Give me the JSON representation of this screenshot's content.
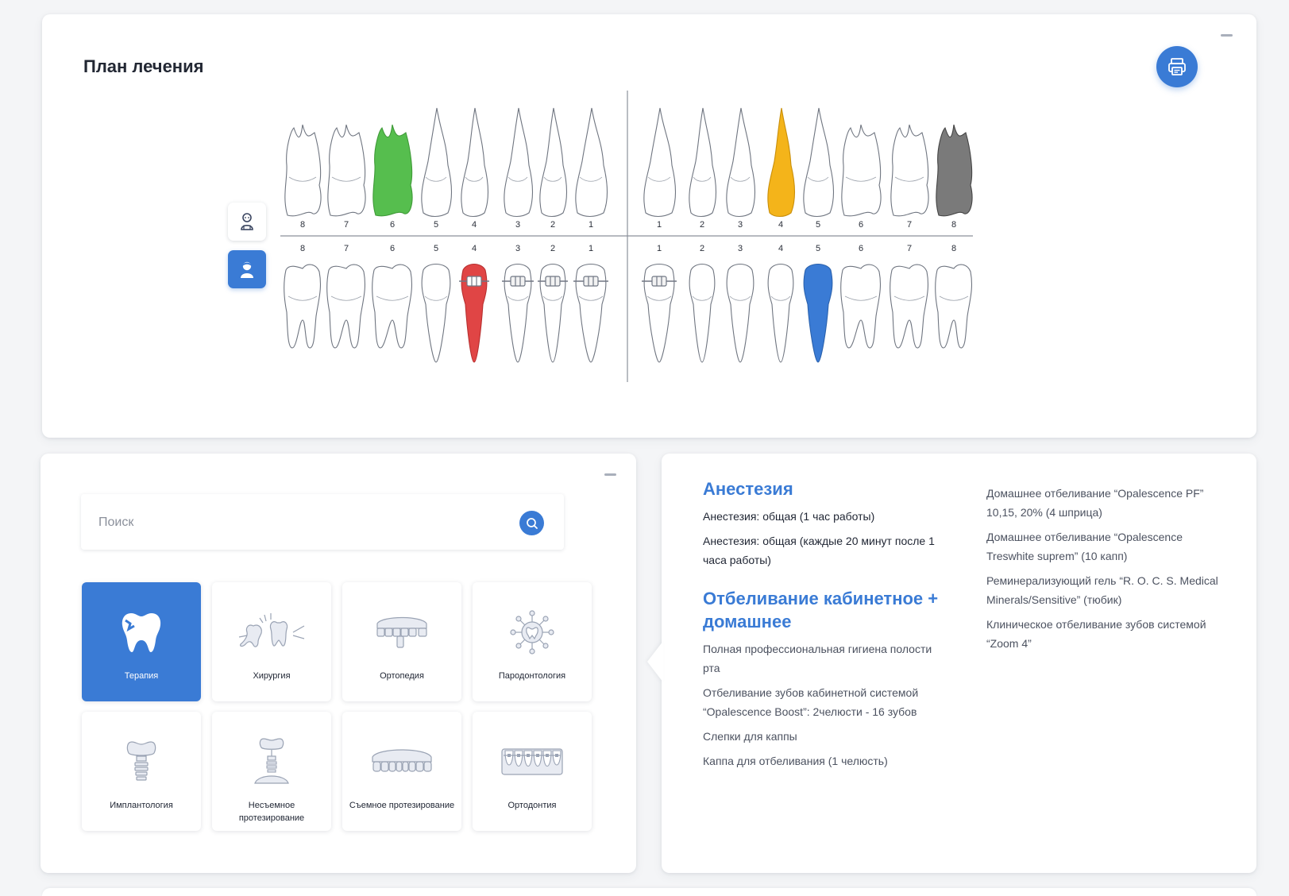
{
  "plan": {
    "title": "План лечения",
    "upper_numbers_left": [
      "8",
      "7",
      "6",
      "5",
      "4",
      "3",
      "2",
      "1"
    ],
    "upper_numbers_right": [
      "1",
      "2",
      "3",
      "4",
      "5",
      "6",
      "7",
      "8"
    ],
    "lower_numbers_left": [
      "8",
      "7",
      "6",
      "5",
      "4",
      "3",
      "2",
      "1"
    ],
    "lower_numbers_right": [
      "1",
      "2",
      "3",
      "4",
      "5",
      "6",
      "7",
      "8"
    ],
    "colors": {
      "green": "#56be4e",
      "yellow": "#f4b41a",
      "gray": "#7a7a7a",
      "red": "#e04545",
      "blue": "#3a7bd5"
    },
    "icons": {
      "print": "printer-icon",
      "child_view": "child-icon",
      "adult_view": "adult-icon"
    }
  },
  "services": {
    "search_placeholder": "Поиск",
    "categories": [
      {
        "label": "Терапия",
        "icon": "tooth-icon",
        "active": true
      },
      {
        "label": "Хирургия",
        "icon": "extraction-icon",
        "active": false
      },
      {
        "label": "Ортопедия",
        "icon": "bridge-icon",
        "active": false
      },
      {
        "label": "Пародонтология",
        "icon": "gum-icon",
        "active": false
      },
      {
        "label": "Имплантология",
        "icon": "implant-icon",
        "active": false
      },
      {
        "label": "Несъемное протезирование",
        "icon": "crown-implant-icon",
        "active": false
      },
      {
        "label": "Съемное протезирование",
        "icon": "denture-icon",
        "active": false
      },
      {
        "label": "Ортодонтия",
        "icon": "braces-icon",
        "active": false
      }
    ]
  },
  "detail": {
    "sections": [
      {
        "heading": "Анестезия",
        "items": [
          "Анестезия: общая (1 час работы)",
          "Анестезия: общая (каждые 20 минут после 1 часа работы)"
        ]
      },
      {
        "heading": "Отбеливание кабинетное + домашнее",
        "items": [
          "Полная профессиональная гигиена полости рта",
          "Отбеливание зубов кабинетной системой “Opalescence Boost”: 2челюсти - 16 зубов",
          "Слепки для каппы",
          "Каппа для отбеливания (1 челюсть)"
        ]
      }
    ],
    "right_items": [
      "Домашнее отбеливание “Opalescence PF” 10,15, 20% (4 шприца)",
      "Домашнее отбеливание “Opalescence Treswhite suprem” (10 капп)",
      "Реминерализующий гель “R. O. C. S. Medical Minerals/Sensitive” (тюбик)",
      "Клиническое отбеливание зубов системой “Zoom 4”"
    ]
  }
}
